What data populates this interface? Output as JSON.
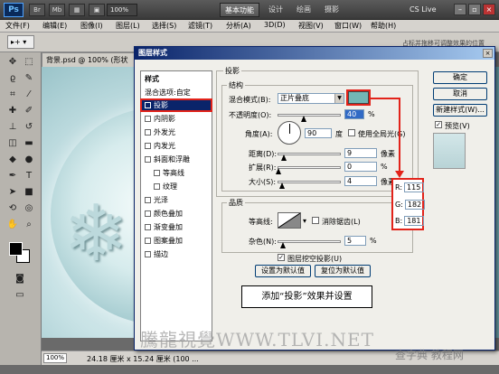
{
  "titlebar": {
    "logo": "Ps",
    "zoom": "100%",
    "workspaces": [
      "基本功能",
      "设计",
      "绘画",
      "摄影"
    ],
    "active_workspace": "基本功能",
    "cs_live": "CS Live"
  },
  "menubar": [
    "文件(F)",
    "编辑(E)",
    "图像(I)",
    "图层(L)",
    "选择(S)",
    "滤镜(T)",
    "分析(A)",
    "3D(D)",
    "视图(V)",
    "窗口(W)",
    "帮助(H)"
  ],
  "options_hint": "占标并拖移可调整效果的位置",
  "document": {
    "tab_label": "背景.psd @ 100% (形状",
    "status_zoom": "100%",
    "status_size": "24.18 厘米 x 15.24 厘米 (100 ..."
  },
  "dialog": {
    "title": "图层样式",
    "style_list_header": "样式",
    "blending_options": "混合选项:自定",
    "styles": [
      {
        "label": "投影",
        "checked": true
      },
      {
        "label": "内阴影",
        "checked": false
      },
      {
        "label": "外发光",
        "checked": false
      },
      {
        "label": "内发光",
        "checked": false
      },
      {
        "label": "斜面和浮雕",
        "checked": false
      },
      {
        "label": "等高线",
        "checked": false
      },
      {
        "label": "纹理",
        "checked": false
      },
      {
        "label": "光泽",
        "checked": false
      },
      {
        "label": "颜色叠加",
        "checked": false
      },
      {
        "label": "渐变叠加",
        "checked": false
      },
      {
        "label": "图案叠加",
        "checked": false
      },
      {
        "label": "描边",
        "checked": false
      }
    ],
    "section_title": "投影",
    "structure_title": "结构",
    "blend_mode_label": "混合模式(B):",
    "blend_mode_value": "正片叠底",
    "shadow_color": "#73b6b5",
    "opacity_label": "不透明度(O):",
    "opacity_value": "40",
    "angle_label": "角度(A):",
    "angle_value": "90",
    "angle_unit": "度",
    "global_light_label": "使用全局光(G)",
    "distance_label": "距离(D):",
    "distance_value": "9",
    "spread_label": "扩展(R):",
    "spread_value": "0",
    "size_label": "大小(S):",
    "size_value": "4",
    "pixel_unit": "像素",
    "percent_unit": "%",
    "quality_title": "品质",
    "contour_label": "等高线:",
    "anti_alias_label": "消除锯齿(L)",
    "noise_label": "杂色(N):",
    "noise_value": "5",
    "knockout_label": "图层挖空投影(U)",
    "make_default": "设置为默认值",
    "reset_default": "复位为默认值",
    "ok": "确定",
    "cancel": "取消",
    "new_style": "新建样式(W)...",
    "preview_label": "预览(V)"
  },
  "rgb": {
    "r_label": "R:",
    "r": "115",
    "g_label": "G:",
    "g": "182",
    "b_label": "B:",
    "b": "181"
  },
  "callout": "添加“投影”效果并设置",
  "watermark": "騰龍視覺WWW.TLVI.NET",
  "watermark2": "查字典 教程网"
}
